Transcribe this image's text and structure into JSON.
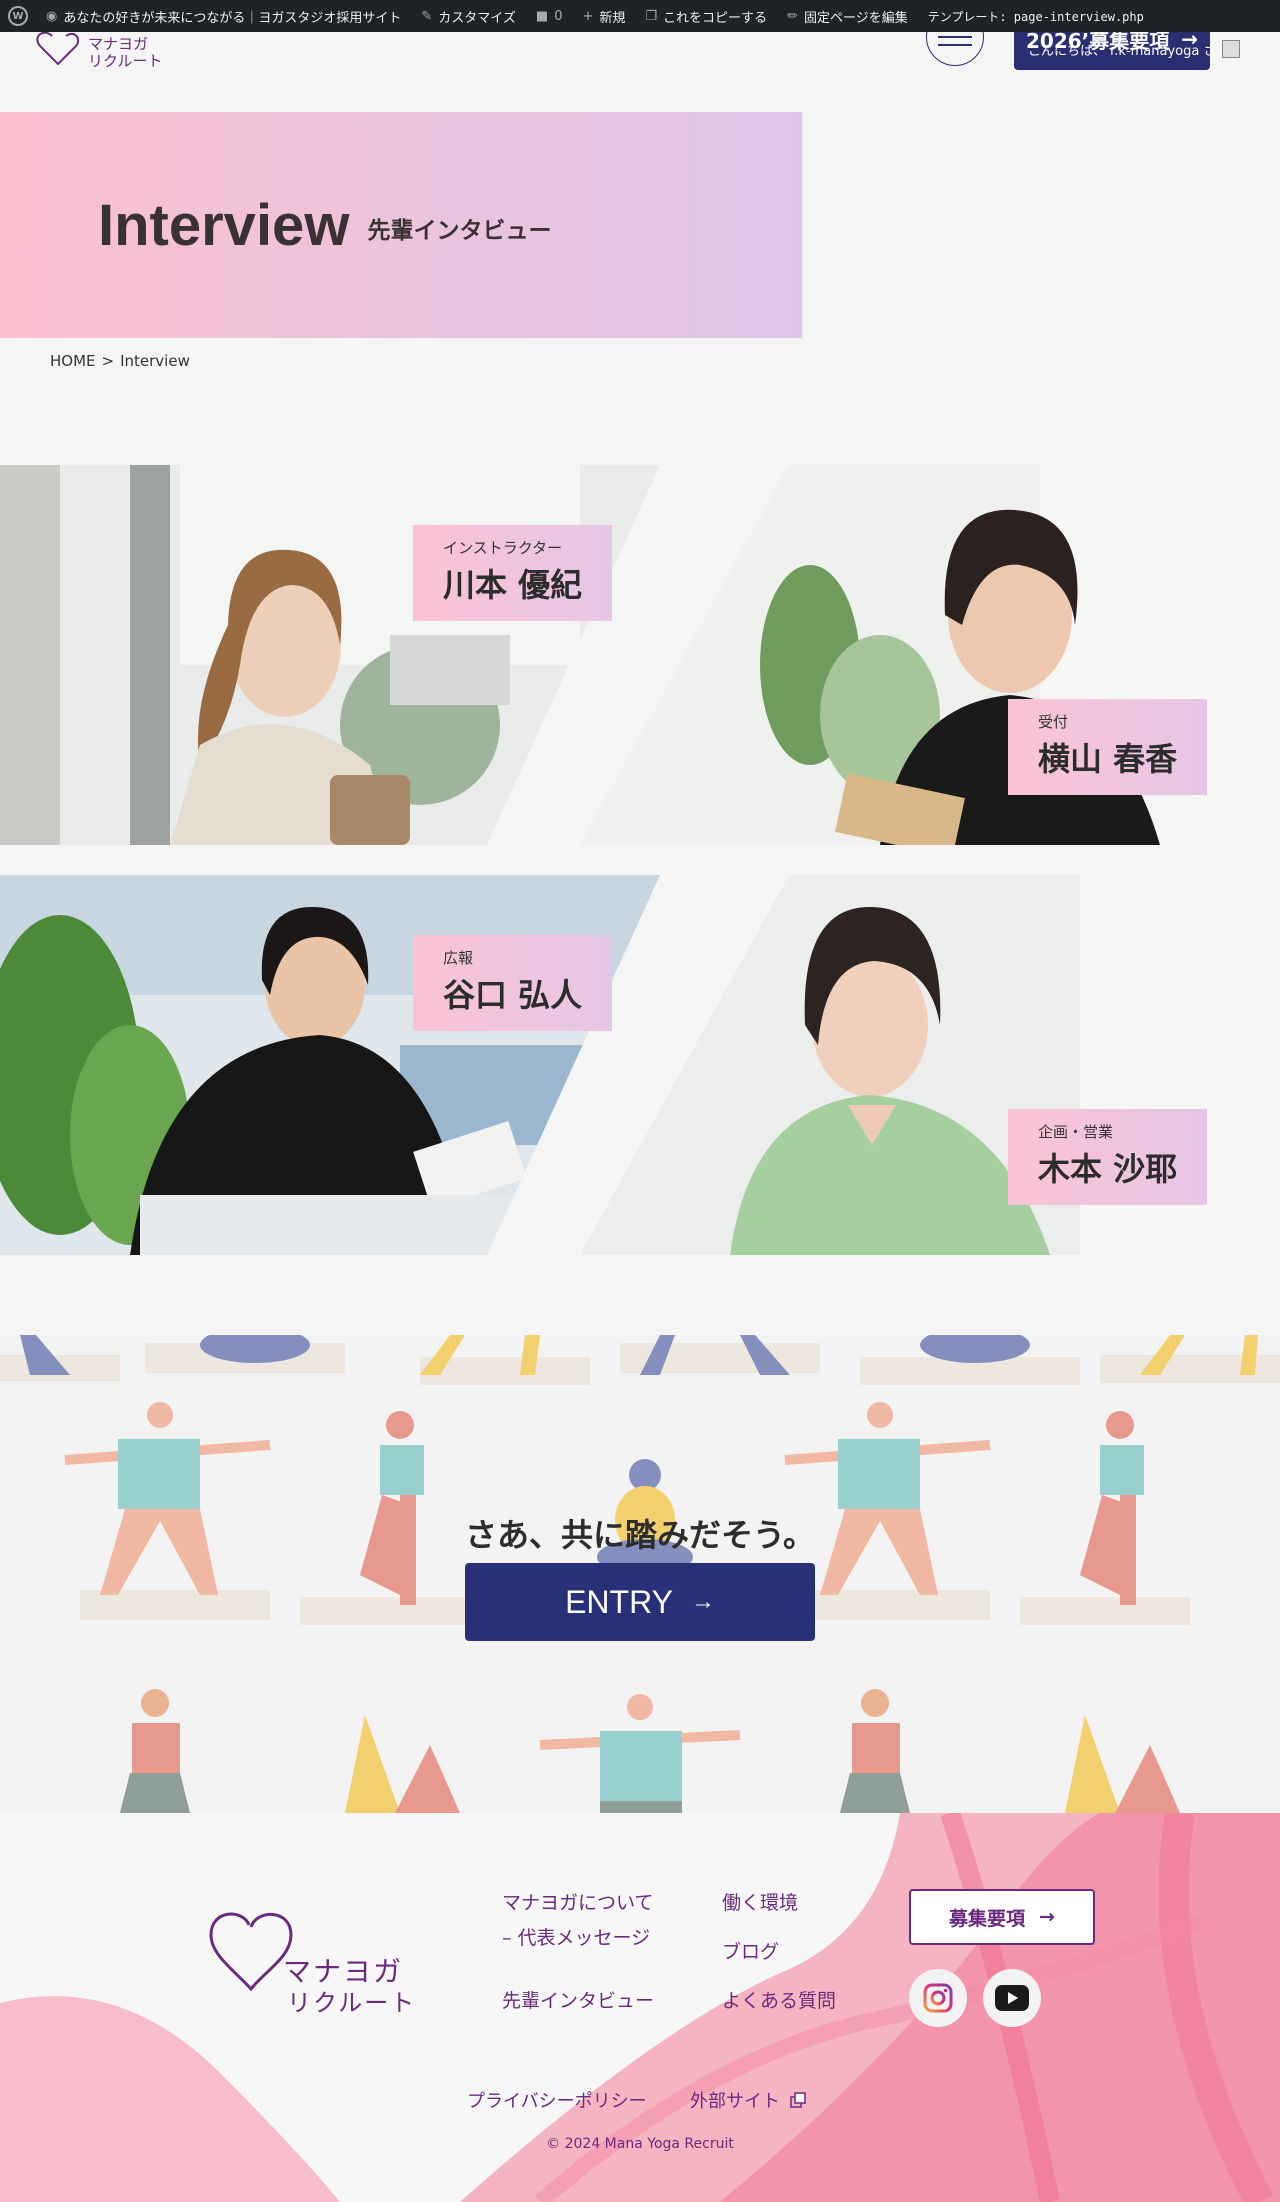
{
  "admin_bar": {
    "site_name": "あなたの好きが未来につながる｜ヨガスタジオ採用サイト",
    "customize": "カスタマイズ",
    "comments_count": "0",
    "new": "新規",
    "copy": "これをコピーする",
    "edit": "固定ページを編集",
    "template": "テンプレート: page-interview.php"
  },
  "header": {
    "logo_line1": "マナヨガ",
    "logo_line2": "リクルート",
    "recruit_button": "2026’募集要項",
    "greeting": "こんにちは、 r.k-manayoga さん"
  },
  "hero": {
    "title": "Interview",
    "subtitle": "先輩インタビュー"
  },
  "breadcrumb": {
    "home": "HOME",
    "separator": ">",
    "current": "Interview"
  },
  "interviews": [
    {
      "role": "インストラクター",
      "name": "川本 優紀"
    },
    {
      "role": "受付",
      "name": "横山 春香"
    },
    {
      "role": "広報",
      "name": "谷口 弘人"
    },
    {
      "role": "企画・営業",
      "name": "木本 沙耶"
    }
  ],
  "entry": {
    "catch": "さあ、共に踏みだそう。",
    "button": "ENTRY"
  },
  "footer": {
    "logo_line1": "マナヨガ",
    "logo_line2": "リクルート",
    "nav": {
      "about_line1": "マナヨガについて",
      "about_line2": "– 代表メッセージ",
      "interview": "先輩インタビュー",
      "environment": "働く環境",
      "blog": "ブログ",
      "faq": "よくある質問"
    },
    "recruit_button": "募集要項",
    "privacy": "プライバシーポリシー",
    "external": "外部サイト",
    "copyright": "© 2024 Mana Yoga Recruit"
  },
  "colors": {
    "navy": "#283178",
    "purple": "#6a2b7e",
    "pink": "#fbc0d0",
    "lavender": "#dfc6e9"
  }
}
